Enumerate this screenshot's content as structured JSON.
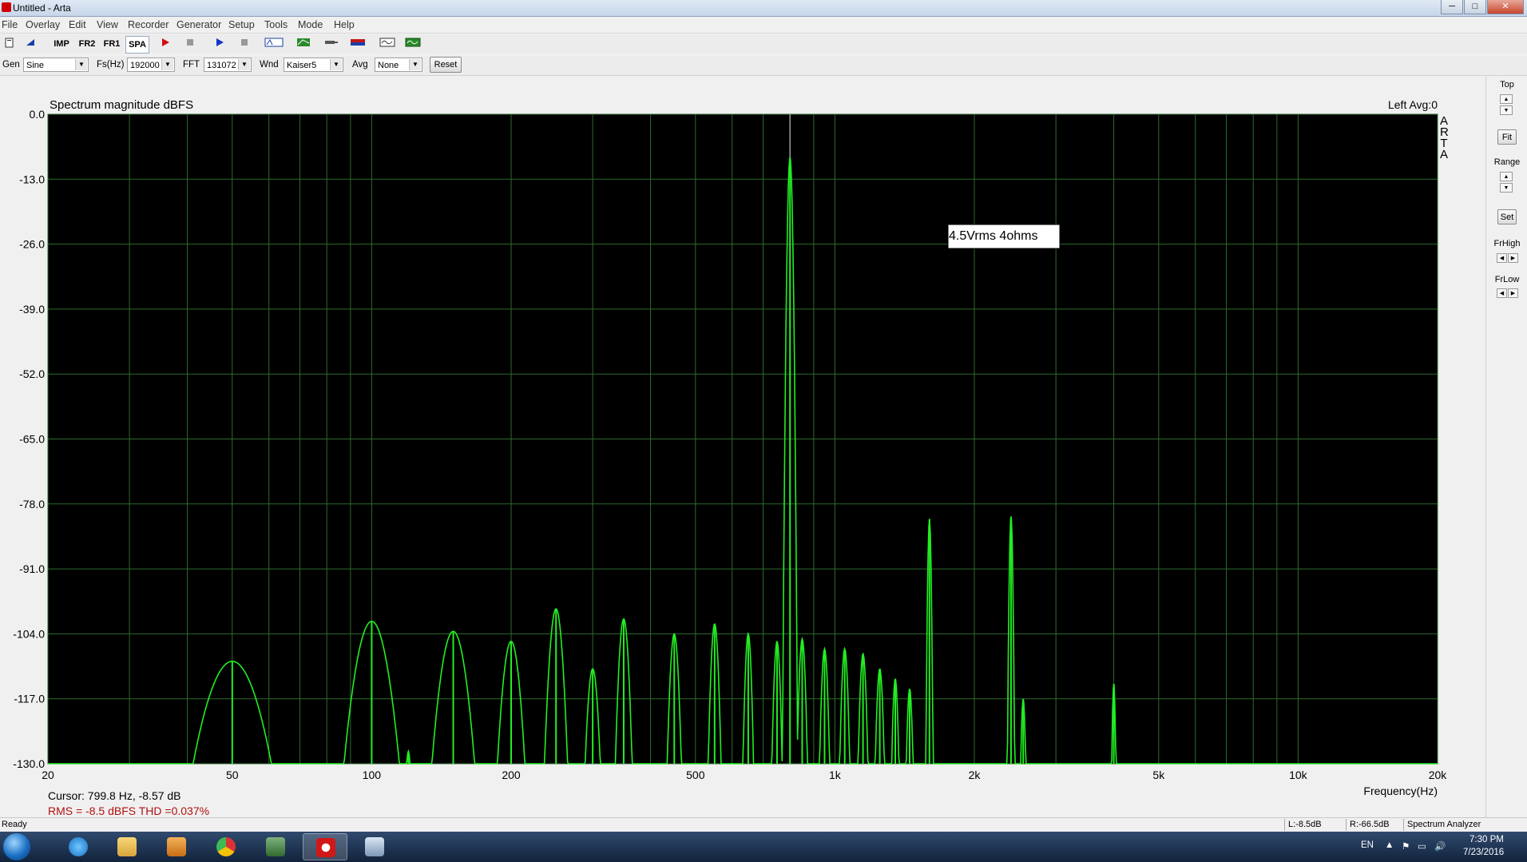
{
  "window": {
    "title": "Untitled - Arta",
    "min": "─",
    "max": "□",
    "close": "✕"
  },
  "menu": [
    "File",
    "Overlay",
    "Edit",
    "View",
    "Recorder",
    "Generator",
    "Setup",
    "Tools",
    "Mode",
    "Help"
  ],
  "toolbar": {
    "imp": "IMP",
    "fr2": "FR2",
    "fr1": "FR1",
    "spa": "SPA"
  },
  "genbar": {
    "gen_label": "Gen",
    "gen_value": "Sine",
    "fs_label": "Fs(Hz)",
    "fs_value": "192000",
    "fft_label": "FFT",
    "fft_value": "131072",
    "wnd_label": "Wnd",
    "wnd_value": "Kaiser5",
    "avg_label": "Avg",
    "avg_value": "None",
    "reset": "Reset"
  },
  "side": {
    "top": "Top",
    "fit": "Fit",
    "range": "Range",
    "set": "Set",
    "frhigh": "FrHigh",
    "frlow": "FrLow"
  },
  "arta_letters": [
    "A",
    "R",
    "T",
    "A"
  ],
  "readout": {
    "cursor": "Cursor:   799.8 Hz, -8.57 dB",
    "rms": "RMS =   -8.5 dBFS   THD =0.037%"
  },
  "chart_data": {
    "type": "line",
    "title": "Spectrum magnitude dBFS",
    "channel_info": "Left  Avg:0",
    "annotation": "4.5Vrms  4ohms",
    "xlabel": "Frequency(Hz)",
    "ylabel": "",
    "x_scale": "log",
    "xlim": [
      20,
      20000
    ],
    "ylim": [
      -130,
      0
    ],
    "grid": true,
    "y_ticks": [
      "0.0",
      "-13.0",
      "-26.0",
      "-39.0",
      "-52.0",
      "-65.0",
      "-78.0",
      "-91.0",
      "-104.0",
      "-117.0",
      "-130.0"
    ],
    "x_tick_labels": [
      {
        "f": 20,
        "t": "20"
      },
      {
        "f": 50,
        "t": "50"
      },
      {
        "f": 100,
        "t": "100"
      },
      {
        "f": 200,
        "t": "200"
      },
      {
        "f": 500,
        "t": "500"
      },
      {
        "f": 1000,
        "t": "1k"
      },
      {
        "f": 2000,
        "t": "2k"
      },
      {
        "f": 5000,
        "t": "5k"
      },
      {
        "f": 10000,
        "t": "10k"
      },
      {
        "f": 20000,
        "t": "20k"
      }
    ],
    "x_grid": [
      30,
      40,
      50,
      60,
      70,
      80,
      90,
      100,
      200,
      300,
      400,
      500,
      600,
      700,
      800,
      900,
      1000,
      2000,
      3000,
      4000,
      5000,
      6000,
      7000,
      8000,
      9000,
      10000
    ],
    "series": [
      {
        "color": "#22ee22",
        "peaks": [
          {
            "f": 800,
            "db": -8.6,
            "w": 0.02
          },
          {
            "f": 1600,
            "db": -81.0,
            "w": 0.015
          },
          {
            "f": 2400,
            "db": -80.5,
            "w": 0.015
          },
          {
            "f": 4000,
            "db": -114.0,
            "w": 0.015
          },
          {
            "f": 50,
            "db": -109.5,
            "w": 0.25
          },
          {
            "f": 100,
            "db": -101.5,
            "w": 0.15
          },
          {
            "f": 150,
            "db": -103.5,
            "w": 0.12
          },
          {
            "f": 200,
            "db": -105.5,
            "w": 0.08
          },
          {
            "f": 250,
            "db": -99.0,
            "w": 0.06
          },
          {
            "f": 300,
            "db": -111.0,
            "w": 0.05
          },
          {
            "f": 350,
            "db": -101.0,
            "w": 0.045
          },
          {
            "f": 450,
            "db": -104.0,
            "w": 0.04
          },
          {
            "f": 550,
            "db": -102.0,
            "w": 0.035
          },
          {
            "f": 650,
            "db": -104.0,
            "w": 0.03
          },
          {
            "f": 750,
            "db": -105.5,
            "w": 0.03
          },
          {
            "f": 850,
            "db": -105.0,
            "w": 0.03
          },
          {
            "f": 950,
            "db": -107.0,
            "w": 0.03
          },
          {
            "f": 1050,
            "db": -107.0,
            "w": 0.03
          },
          {
            "f": 1150,
            "db": -108.0,
            "w": 0.03
          },
          {
            "f": 1250,
            "db": -111.0,
            "w": 0.03
          },
          {
            "f": 1350,
            "db": -113.0,
            "w": 0.025
          },
          {
            "f": 1450,
            "db": -115.0,
            "w": 0.025
          },
          {
            "f": 2550,
            "db": -117.0,
            "w": 0.02
          },
          {
            "f": 120,
            "db": -127.5,
            "w": 0.03
          }
        ]
      }
    ]
  }
}
